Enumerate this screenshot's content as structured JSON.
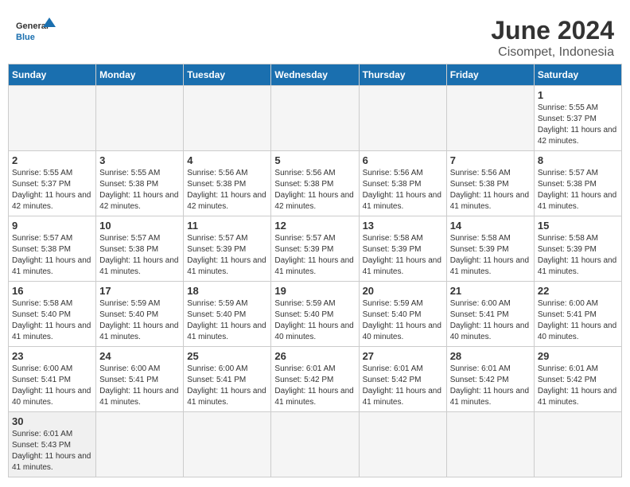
{
  "logo": {
    "text_general": "General",
    "text_blue": "Blue"
  },
  "title": "June 2024",
  "subtitle": "Cisompet, Indonesia",
  "days_of_week": [
    "Sunday",
    "Monday",
    "Tuesday",
    "Wednesday",
    "Thursday",
    "Friday",
    "Saturday"
  ],
  "weeks": [
    [
      {
        "day": "",
        "info": ""
      },
      {
        "day": "",
        "info": ""
      },
      {
        "day": "",
        "info": ""
      },
      {
        "day": "",
        "info": ""
      },
      {
        "day": "",
        "info": ""
      },
      {
        "day": "",
        "info": ""
      },
      {
        "day": "1",
        "info": "Sunrise: 5:55 AM\nSunset: 5:37 PM\nDaylight: 11 hours\nand 42 minutes."
      }
    ],
    [
      {
        "day": "2",
        "info": "Sunrise: 5:55 AM\nSunset: 5:37 PM\nDaylight: 11 hours\nand 42 minutes."
      },
      {
        "day": "3",
        "info": "Sunrise: 5:55 AM\nSunset: 5:38 PM\nDaylight: 11 hours\nand 42 minutes."
      },
      {
        "day": "4",
        "info": "Sunrise: 5:56 AM\nSunset: 5:38 PM\nDaylight: 11 hours\nand 42 minutes."
      },
      {
        "day": "5",
        "info": "Sunrise: 5:56 AM\nSunset: 5:38 PM\nDaylight: 11 hours\nand 42 minutes."
      },
      {
        "day": "6",
        "info": "Sunrise: 5:56 AM\nSunset: 5:38 PM\nDaylight: 11 hours\nand 41 minutes."
      },
      {
        "day": "7",
        "info": "Sunrise: 5:56 AM\nSunset: 5:38 PM\nDaylight: 11 hours\nand 41 minutes."
      },
      {
        "day": "8",
        "info": "Sunrise: 5:57 AM\nSunset: 5:38 PM\nDaylight: 11 hours\nand 41 minutes."
      }
    ],
    [
      {
        "day": "9",
        "info": "Sunrise: 5:57 AM\nSunset: 5:38 PM\nDaylight: 11 hours\nand 41 minutes."
      },
      {
        "day": "10",
        "info": "Sunrise: 5:57 AM\nSunset: 5:38 PM\nDaylight: 11 hours\nand 41 minutes."
      },
      {
        "day": "11",
        "info": "Sunrise: 5:57 AM\nSunset: 5:39 PM\nDaylight: 11 hours\nand 41 minutes."
      },
      {
        "day": "12",
        "info": "Sunrise: 5:57 AM\nSunset: 5:39 PM\nDaylight: 11 hours\nand 41 minutes."
      },
      {
        "day": "13",
        "info": "Sunrise: 5:58 AM\nSunset: 5:39 PM\nDaylight: 11 hours\nand 41 minutes."
      },
      {
        "day": "14",
        "info": "Sunrise: 5:58 AM\nSunset: 5:39 PM\nDaylight: 11 hours\nand 41 minutes."
      },
      {
        "day": "15",
        "info": "Sunrise: 5:58 AM\nSunset: 5:39 PM\nDaylight: 11 hours\nand 41 minutes."
      }
    ],
    [
      {
        "day": "16",
        "info": "Sunrise: 5:58 AM\nSunset: 5:40 PM\nDaylight: 11 hours\nand 41 minutes."
      },
      {
        "day": "17",
        "info": "Sunrise: 5:59 AM\nSunset: 5:40 PM\nDaylight: 11 hours\nand 41 minutes."
      },
      {
        "day": "18",
        "info": "Sunrise: 5:59 AM\nSunset: 5:40 PM\nDaylight: 11 hours\nand 41 minutes."
      },
      {
        "day": "19",
        "info": "Sunrise: 5:59 AM\nSunset: 5:40 PM\nDaylight: 11 hours\nand 40 minutes."
      },
      {
        "day": "20",
        "info": "Sunrise: 5:59 AM\nSunset: 5:40 PM\nDaylight: 11 hours\nand 40 minutes."
      },
      {
        "day": "21",
        "info": "Sunrise: 6:00 AM\nSunset: 5:41 PM\nDaylight: 11 hours\nand 40 minutes."
      },
      {
        "day": "22",
        "info": "Sunrise: 6:00 AM\nSunset: 5:41 PM\nDaylight: 11 hours\nand 40 minutes."
      }
    ],
    [
      {
        "day": "23",
        "info": "Sunrise: 6:00 AM\nSunset: 5:41 PM\nDaylight: 11 hours\nand 40 minutes."
      },
      {
        "day": "24",
        "info": "Sunrise: 6:00 AM\nSunset: 5:41 PM\nDaylight: 11 hours\nand 41 minutes."
      },
      {
        "day": "25",
        "info": "Sunrise: 6:00 AM\nSunset: 5:41 PM\nDaylight: 11 hours\nand 41 minutes."
      },
      {
        "day": "26",
        "info": "Sunrise: 6:01 AM\nSunset: 5:42 PM\nDaylight: 11 hours\nand 41 minutes."
      },
      {
        "day": "27",
        "info": "Sunrise: 6:01 AM\nSunset: 5:42 PM\nDaylight: 11 hours\nand 41 minutes."
      },
      {
        "day": "28",
        "info": "Sunrise: 6:01 AM\nSunset: 5:42 PM\nDaylight: 11 hours\nand 41 minutes."
      },
      {
        "day": "29",
        "info": "Sunrise: 6:01 AM\nSunset: 5:42 PM\nDaylight: 11 hours\nand 41 minutes."
      }
    ],
    [
      {
        "day": "30",
        "info": "Sunrise: 6:01 AM\nSunset: 5:43 PM\nDaylight: 11 hours\nand 41 minutes."
      },
      {
        "day": "",
        "info": ""
      },
      {
        "day": "",
        "info": ""
      },
      {
        "day": "",
        "info": ""
      },
      {
        "day": "",
        "info": ""
      },
      {
        "day": "",
        "info": ""
      },
      {
        "day": "",
        "info": ""
      }
    ]
  ]
}
